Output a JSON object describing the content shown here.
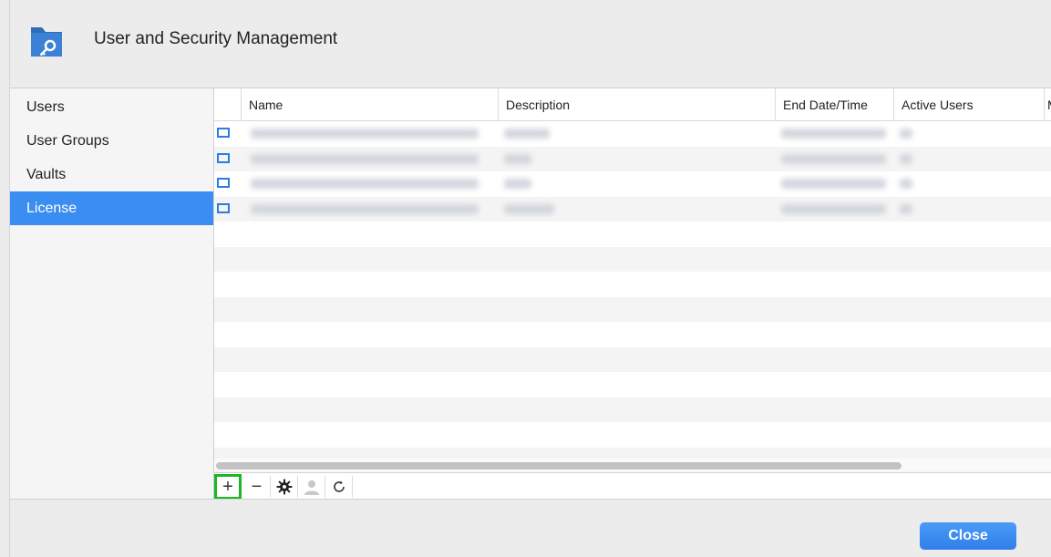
{
  "window": {
    "title": "User and Security Management",
    "logo_icon": "folder-key-icon",
    "accent_color": "#3b8ef1"
  },
  "sidebar": {
    "items": [
      {
        "label": "Users",
        "selected": false
      },
      {
        "label": "User Groups",
        "selected": false
      },
      {
        "label": "Vaults",
        "selected": false
      },
      {
        "label": "License",
        "selected": true
      }
    ]
  },
  "table": {
    "columns": [
      "Name",
      "Description",
      "End Date/Time",
      "Active Users",
      "M"
    ],
    "rows": [
      {
        "icon": "license-icon",
        "redacted": true
      },
      {
        "icon": "license-icon",
        "redacted": true
      },
      {
        "icon": "license-icon",
        "redacted": true
      },
      {
        "icon": "license-icon",
        "redacted": true
      }
    ]
  },
  "toolbar": {
    "add": "+",
    "remove": "−",
    "settings_icon": "gear-icon",
    "user_icon": "user-icon",
    "refresh_icon": "refresh-icon",
    "highlight_color": "#19b824"
  },
  "footer": {
    "close_label": "Close"
  }
}
